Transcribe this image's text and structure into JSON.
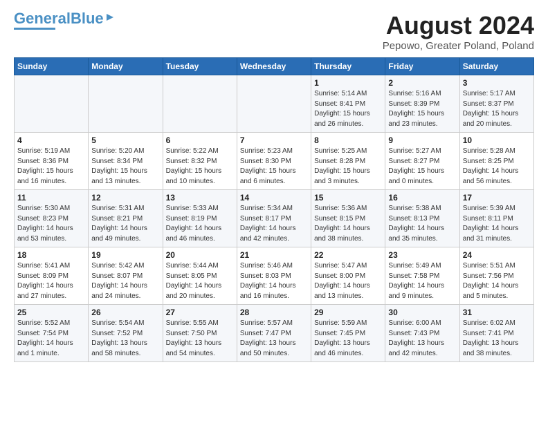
{
  "header": {
    "logo_line1": "General",
    "logo_line2": "Blue",
    "month_title": "August 2024",
    "location": "Pepowo, Greater Poland, Poland"
  },
  "days_of_week": [
    "Sunday",
    "Monday",
    "Tuesday",
    "Wednesday",
    "Thursday",
    "Friday",
    "Saturday"
  ],
  "weeks": [
    [
      {
        "day": "",
        "info": ""
      },
      {
        "day": "",
        "info": ""
      },
      {
        "day": "",
        "info": ""
      },
      {
        "day": "",
        "info": ""
      },
      {
        "day": "1",
        "info": "Sunrise: 5:14 AM\nSunset: 8:41 PM\nDaylight: 15 hours\nand 26 minutes."
      },
      {
        "day": "2",
        "info": "Sunrise: 5:16 AM\nSunset: 8:39 PM\nDaylight: 15 hours\nand 23 minutes."
      },
      {
        "day": "3",
        "info": "Sunrise: 5:17 AM\nSunset: 8:37 PM\nDaylight: 15 hours\nand 20 minutes."
      }
    ],
    [
      {
        "day": "4",
        "info": "Sunrise: 5:19 AM\nSunset: 8:36 PM\nDaylight: 15 hours\nand 16 minutes."
      },
      {
        "day": "5",
        "info": "Sunrise: 5:20 AM\nSunset: 8:34 PM\nDaylight: 15 hours\nand 13 minutes."
      },
      {
        "day": "6",
        "info": "Sunrise: 5:22 AM\nSunset: 8:32 PM\nDaylight: 15 hours\nand 10 minutes."
      },
      {
        "day": "7",
        "info": "Sunrise: 5:23 AM\nSunset: 8:30 PM\nDaylight: 15 hours\nand 6 minutes."
      },
      {
        "day": "8",
        "info": "Sunrise: 5:25 AM\nSunset: 8:28 PM\nDaylight: 15 hours\nand 3 minutes."
      },
      {
        "day": "9",
        "info": "Sunrise: 5:27 AM\nSunset: 8:27 PM\nDaylight: 15 hours\nand 0 minutes."
      },
      {
        "day": "10",
        "info": "Sunrise: 5:28 AM\nSunset: 8:25 PM\nDaylight: 14 hours\nand 56 minutes."
      }
    ],
    [
      {
        "day": "11",
        "info": "Sunrise: 5:30 AM\nSunset: 8:23 PM\nDaylight: 14 hours\nand 53 minutes."
      },
      {
        "day": "12",
        "info": "Sunrise: 5:31 AM\nSunset: 8:21 PM\nDaylight: 14 hours\nand 49 minutes."
      },
      {
        "day": "13",
        "info": "Sunrise: 5:33 AM\nSunset: 8:19 PM\nDaylight: 14 hours\nand 46 minutes."
      },
      {
        "day": "14",
        "info": "Sunrise: 5:34 AM\nSunset: 8:17 PM\nDaylight: 14 hours\nand 42 minutes."
      },
      {
        "day": "15",
        "info": "Sunrise: 5:36 AM\nSunset: 8:15 PM\nDaylight: 14 hours\nand 38 minutes."
      },
      {
        "day": "16",
        "info": "Sunrise: 5:38 AM\nSunset: 8:13 PM\nDaylight: 14 hours\nand 35 minutes."
      },
      {
        "day": "17",
        "info": "Sunrise: 5:39 AM\nSunset: 8:11 PM\nDaylight: 14 hours\nand 31 minutes."
      }
    ],
    [
      {
        "day": "18",
        "info": "Sunrise: 5:41 AM\nSunset: 8:09 PM\nDaylight: 14 hours\nand 27 minutes."
      },
      {
        "day": "19",
        "info": "Sunrise: 5:42 AM\nSunset: 8:07 PM\nDaylight: 14 hours\nand 24 minutes."
      },
      {
        "day": "20",
        "info": "Sunrise: 5:44 AM\nSunset: 8:05 PM\nDaylight: 14 hours\nand 20 minutes."
      },
      {
        "day": "21",
        "info": "Sunrise: 5:46 AM\nSunset: 8:03 PM\nDaylight: 14 hours\nand 16 minutes."
      },
      {
        "day": "22",
        "info": "Sunrise: 5:47 AM\nSunset: 8:00 PM\nDaylight: 14 hours\nand 13 minutes."
      },
      {
        "day": "23",
        "info": "Sunrise: 5:49 AM\nSunset: 7:58 PM\nDaylight: 14 hours\nand 9 minutes."
      },
      {
        "day": "24",
        "info": "Sunrise: 5:51 AM\nSunset: 7:56 PM\nDaylight: 14 hours\nand 5 minutes."
      }
    ],
    [
      {
        "day": "25",
        "info": "Sunrise: 5:52 AM\nSunset: 7:54 PM\nDaylight: 14 hours\nand 1 minute."
      },
      {
        "day": "26",
        "info": "Sunrise: 5:54 AM\nSunset: 7:52 PM\nDaylight: 13 hours\nand 58 minutes."
      },
      {
        "day": "27",
        "info": "Sunrise: 5:55 AM\nSunset: 7:50 PM\nDaylight: 13 hours\nand 54 minutes."
      },
      {
        "day": "28",
        "info": "Sunrise: 5:57 AM\nSunset: 7:47 PM\nDaylight: 13 hours\nand 50 minutes."
      },
      {
        "day": "29",
        "info": "Sunrise: 5:59 AM\nSunset: 7:45 PM\nDaylight: 13 hours\nand 46 minutes."
      },
      {
        "day": "30",
        "info": "Sunrise: 6:00 AM\nSunset: 7:43 PM\nDaylight: 13 hours\nand 42 minutes."
      },
      {
        "day": "31",
        "info": "Sunrise: 6:02 AM\nSunset: 7:41 PM\nDaylight: 13 hours\nand 38 minutes."
      }
    ]
  ]
}
